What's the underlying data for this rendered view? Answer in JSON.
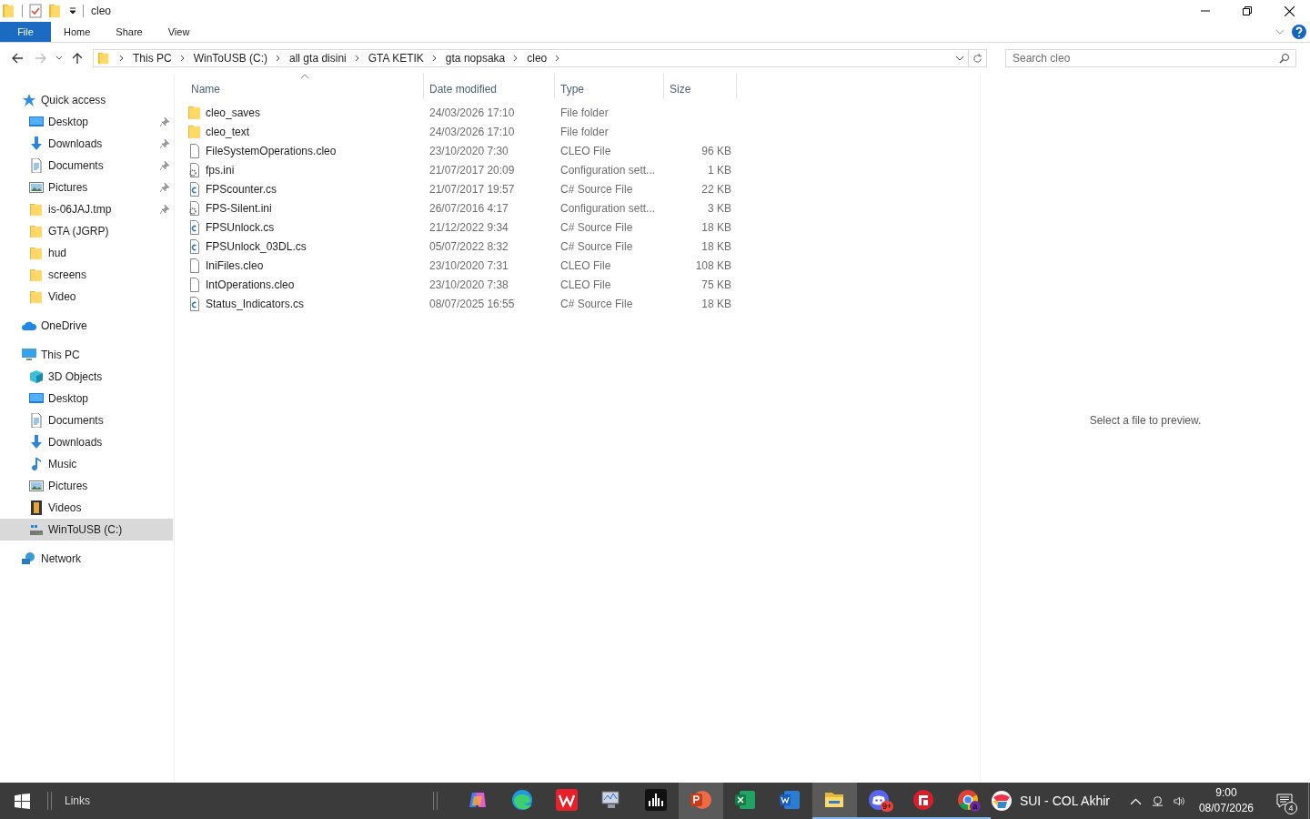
{
  "window": {
    "title": "cleo"
  },
  "ribbon_tabs": [
    {
      "label": "File",
      "selected": true
    },
    {
      "label": "Home",
      "selected": false
    },
    {
      "label": "Share",
      "selected": false
    },
    {
      "label": "View",
      "selected": false
    }
  ],
  "address_bar": {
    "path": [
      "This PC",
      "WinToUSB (C:)",
      "all gta disini",
      "GTA KETIK",
      "gta nopsaka",
      "cleo"
    ]
  },
  "search": {
    "placeholder": "Search cleo"
  },
  "sidebar": {
    "items": [
      {
        "label": "Quick access",
        "kind": "star",
        "selected": false,
        "children": [
          {
            "label": "Desktop",
            "kind": "desktop",
            "pinned": true,
            "selected": false
          },
          {
            "label": "Downloads",
            "kind": "download",
            "pinned": true,
            "selected": false
          },
          {
            "label": "Documents",
            "kind": "document",
            "pinned": true,
            "selected": false
          },
          {
            "label": "Pictures",
            "kind": "picture",
            "pinned": true,
            "selected": false
          },
          {
            "label": "is-06JAJ.tmp",
            "kind": "folder",
            "pinned": true,
            "selected": false
          },
          {
            "label": "GTA (JGRP)",
            "kind": "folder",
            "pinned": false,
            "selected": false
          },
          {
            "label": "hud",
            "kind": "folder",
            "pinned": false,
            "selected": false
          },
          {
            "label": "screens",
            "kind": "folder",
            "pinned": false,
            "selected": false
          },
          {
            "label": "Video",
            "kind": "folder",
            "pinned": false,
            "selected": false
          }
        ]
      },
      {
        "label": "OneDrive",
        "kind": "cloud",
        "selected": false
      },
      {
        "label": "This PC",
        "kind": "pc",
        "selected": false,
        "children": [
          {
            "label": "3D Objects",
            "kind": "cube",
            "pinned": false,
            "selected": false
          },
          {
            "label": "Desktop",
            "kind": "desktop",
            "pinned": false,
            "selected": false
          },
          {
            "label": "Documents",
            "kind": "document",
            "pinned": false,
            "selected": false
          },
          {
            "label": "Downloads",
            "kind": "download",
            "pinned": false,
            "selected": false
          },
          {
            "label": "Music",
            "kind": "music",
            "pinned": false,
            "selected": false
          },
          {
            "label": "Pictures",
            "kind": "picture",
            "pinned": false,
            "selected": false
          },
          {
            "label": "Videos",
            "kind": "film",
            "pinned": false,
            "selected": false
          },
          {
            "label": "WinToUSB (C:)",
            "kind": "drive",
            "pinned": false,
            "selected": true
          }
        ]
      },
      {
        "label": "Network",
        "kind": "network",
        "selected": false
      }
    ]
  },
  "table": {
    "columns": [
      "Name",
      "Date modified",
      "Type",
      "Size"
    ],
    "rows": [
      {
        "kind": "folder",
        "name": "cleo_saves",
        "date": "24/03/2026 17:10",
        "type": "File folder"
      },
      {
        "kind": "folder",
        "name": "cleo_text",
        "date": "24/03/2026 17:10",
        "type": "File folder"
      },
      {
        "kind": "file",
        "name": "FileSystemOperations.cleo",
        "date": "23/10/2020 7:30",
        "type": "CLEO File",
        "size": "96 KB"
      },
      {
        "kind": "settings",
        "name": "fps.ini",
        "date": "21/07/2017 20:09",
        "type": "Configuration sett...",
        "size": "1 KB"
      },
      {
        "kind": "source",
        "name": "FPScounter.cs",
        "date": "21/07/2017 19:57",
        "type": "C# Source File",
        "size": "22 KB"
      },
      {
        "kind": "settings",
        "name": "FPS-Silent.ini",
        "date": "26/07/2016 4:17",
        "type": "Configuration sett...",
        "size": "3 KB"
      },
      {
        "kind": "source",
        "name": "FPSUnlock.cs",
        "date": "21/12/2022 9:34",
        "type": "C# Source File",
        "size": "18 KB"
      },
      {
        "kind": "source",
        "name": "FPSUnlock_03DL.cs",
        "date": "05/07/2022 8:32",
        "type": "C# Source File",
        "size": "18 KB"
      },
      {
        "kind": "file",
        "name": "IniFiles.cleo",
        "date": "23/10/2020 7:31",
        "type": "CLEO File",
        "size": "108 KB"
      },
      {
        "kind": "file",
        "name": "IntOperations.cleo",
        "date": "23/10/2020 7:38",
        "type": "CLEO File",
        "size": "75 KB"
      },
      {
        "kind": "source",
        "name": "Status_Indicators.cs",
        "date": "08/07/2025 16:55",
        "type": "C# Source File",
        "size": "18 KB"
      }
    ]
  },
  "preview": {
    "message": "Select a file to preview."
  },
  "taskbar": {
    "toolbar_label": "Links",
    "apps": [
      {
        "kind": "copilot",
        "running": false,
        "highlighted": false
      },
      {
        "kind": "edge",
        "running": false,
        "highlighted": false
      },
      {
        "kind": "wps",
        "running": false,
        "highlighted": false
      },
      {
        "kind": "monitor",
        "running": false,
        "highlighted": false
      },
      {
        "kind": "bars",
        "running": false,
        "highlighted": false
      },
      {
        "kind": "powerpoint",
        "running": false,
        "highlighted": true
      },
      {
        "kind": "excel",
        "running": false,
        "highlighted": false
      },
      {
        "kind": "word",
        "running": false,
        "highlighted": false
      },
      {
        "kind": "explorer",
        "running": true,
        "highlighted": true
      },
      {
        "kind": "discord",
        "running": true,
        "highlighted": false,
        "badge": "9+"
      },
      {
        "kind": "redapp",
        "running": true,
        "highlighted": false
      },
      {
        "kind": "chrome",
        "running": true,
        "highlighted": false,
        "badge": "a"
      }
    ],
    "widget": "SUI - COL Akhir",
    "time": "9:00",
    "date": "08/07/2026",
    "notifications": "4"
  }
}
